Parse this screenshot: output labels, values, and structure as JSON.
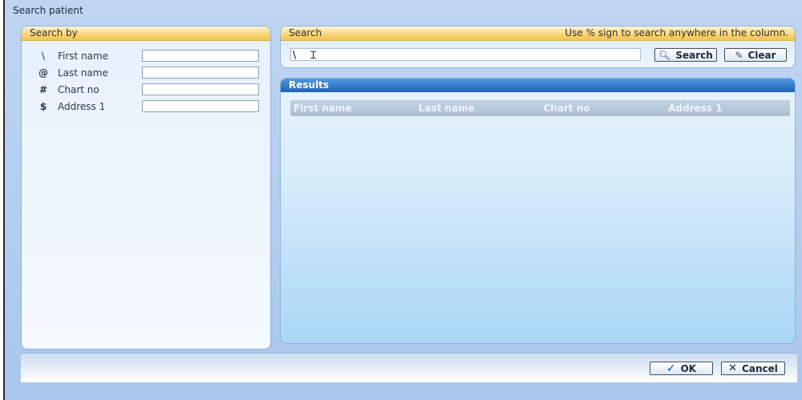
{
  "window": {
    "title": "Search patient"
  },
  "search_by": {
    "title": "Search by",
    "criteria": [
      {
        "symbol": "\\",
        "label": "First name",
        "value": ""
      },
      {
        "symbol": "@",
        "label": "Last name",
        "value": ""
      },
      {
        "symbol": "#",
        "label": "Chart no",
        "value": ""
      },
      {
        "symbol": "$",
        "label": "Address 1",
        "value": ""
      }
    ]
  },
  "search": {
    "title": "Search",
    "hint": "Use % sign to search anywhere in the column.",
    "value": "\\",
    "search_label": "Search",
    "clear_label": "Clear"
  },
  "results": {
    "title": "Results",
    "columns": [
      "First name",
      "Last name",
      "Chart no",
      "Address 1"
    ]
  },
  "footer": {
    "ok_label": "OK",
    "cancel_label": "Cancel"
  },
  "colors": {
    "panel_header": "#f7cf6c",
    "results_header": "#1f63b8",
    "window_bg": "#bfd6f2"
  }
}
